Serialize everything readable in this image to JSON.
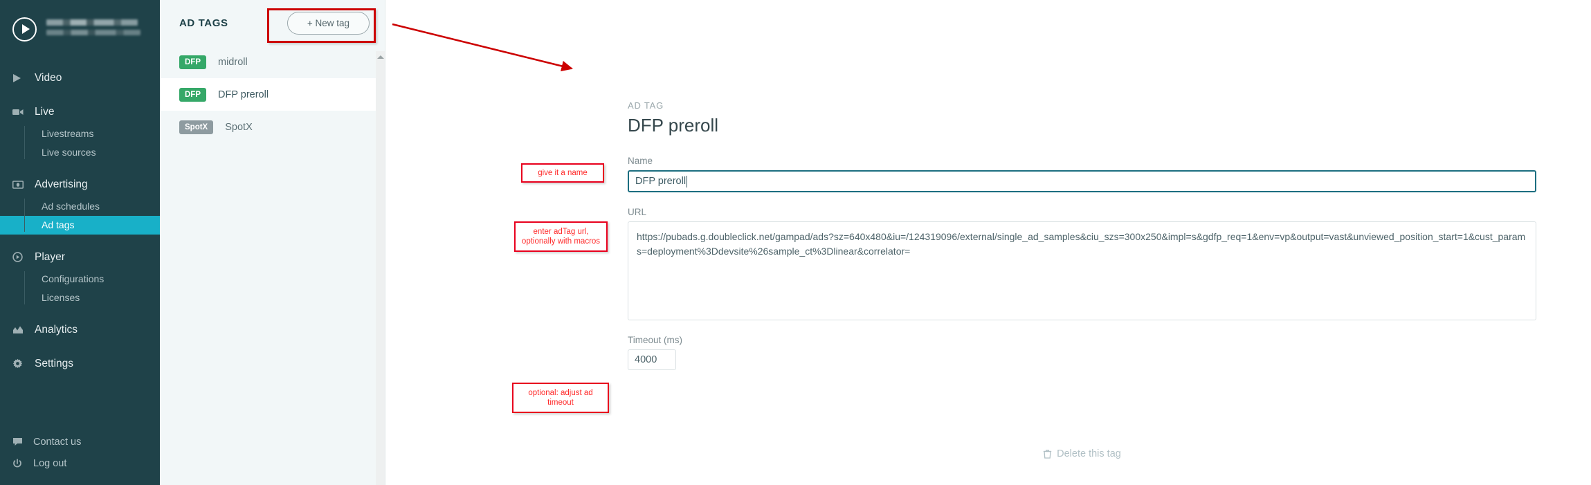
{
  "sidebar": {
    "brand": {
      "logo_icon": "play-circle-icon",
      "name_redacted": "",
      "subtitle_redacted": ""
    },
    "groups": [
      {
        "icon": "play-triangle-icon",
        "label": "Video",
        "children": []
      },
      {
        "icon": "video-camera-icon",
        "label": "Live",
        "children": [
          "Livestreams",
          "Live sources"
        ]
      },
      {
        "icon": "banknote-icon",
        "label": "Advertising",
        "children": [
          "Ad schedules",
          "Ad tags"
        ]
      },
      {
        "icon": "play-circle-outline-icon",
        "label": "Player",
        "children": [
          "Configurations",
          "Licenses"
        ]
      },
      {
        "icon": "chart-icon",
        "label": "Analytics",
        "children": []
      },
      {
        "icon": "gear-icon",
        "label": "Settings",
        "children": []
      }
    ],
    "active_child": "Ad tags",
    "footer": [
      {
        "icon": "chat-bubble-icon",
        "label": "Contact us"
      },
      {
        "icon": "power-icon",
        "label": "Log out"
      }
    ]
  },
  "taglist": {
    "title": "AD TAGS",
    "new_tag_label": "+ New tag",
    "items": [
      {
        "badge": "DFP",
        "badge_type": "dfp",
        "name": "midroll",
        "selected": false
      },
      {
        "badge": "DFP",
        "badge_type": "dfp",
        "name": "DFP preroll",
        "selected": true
      },
      {
        "badge": "SpotX",
        "badge_type": "spotx",
        "name": "SpotX",
        "selected": false
      }
    ]
  },
  "main": {
    "eyebrow": "AD TAG",
    "title": "DFP preroll",
    "fields": {
      "name_label": "Name",
      "name_value": "DFP preroll",
      "url_label": "URL",
      "url_value": "https://pubads.g.doubleclick.net/gampad/ads?sz=640x480&iu=/124319096/external/single_ad_samples&ciu_szs=300x250&impl=s&gdfp_req=1&env=vp&output=vast&unviewed_position_start=1&cust_params=deployment%3Ddevsite%26sample_ct%3Dlinear&correlator=",
      "timeout_label": "Timeout (ms)",
      "timeout_value": "4000"
    },
    "delete_label": "Delete this tag",
    "delete_icon": "trash-icon"
  },
  "annotations": [
    {
      "id": "new-tag-highlight",
      "text": ""
    },
    {
      "id": "name-callout",
      "text": "give it a name"
    },
    {
      "id": "url-callout",
      "text": "enter adTag url,\noptionally with macros"
    },
    {
      "id": "timeout-callout",
      "text": "optional: adjust ad\ntimeout"
    }
  ],
  "colors": {
    "sidebar_bg": "#1f4249",
    "accent": "#18b0c8",
    "badge_dfp": "#35a868",
    "badge_spotx": "#8e9ba0",
    "annotation_red": "#e8001d",
    "input_focus": "#1c6e80"
  }
}
